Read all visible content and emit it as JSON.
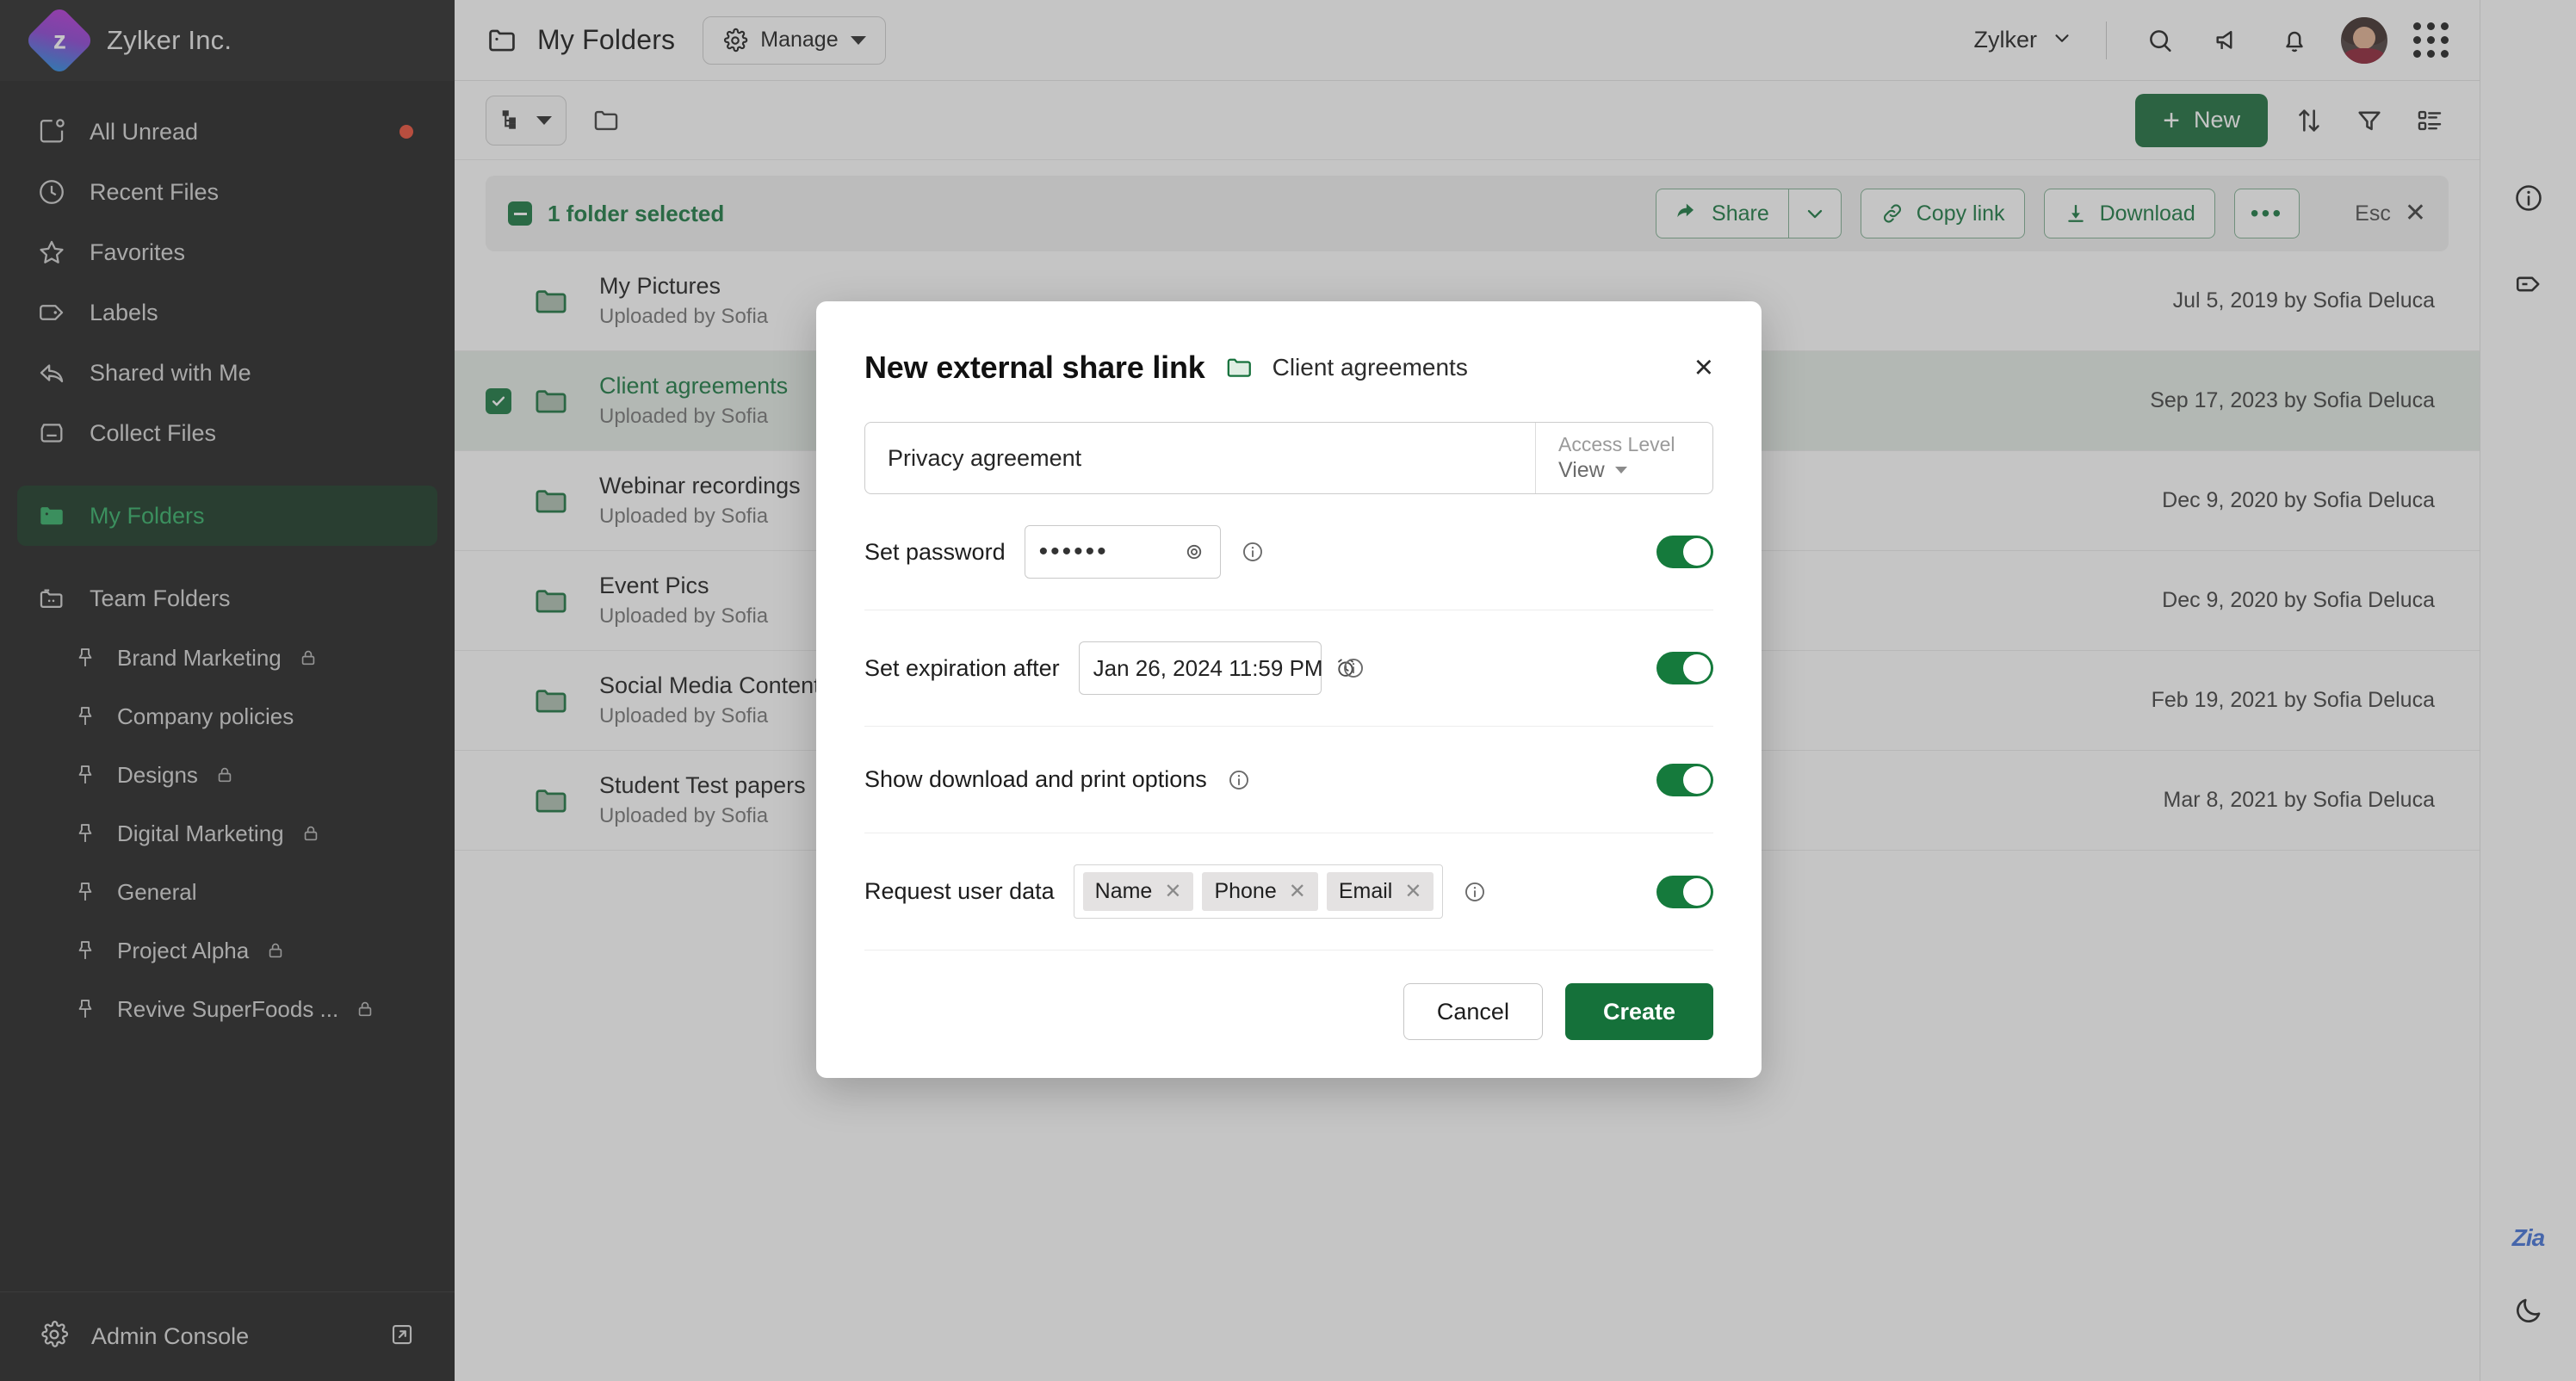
{
  "brand": {
    "name": "Zylker Inc.",
    "logo_letter": "z"
  },
  "sidebar": {
    "items": [
      {
        "label": "All Unread",
        "icon": "unread-icon",
        "badge": true
      },
      {
        "label": "Recent Files",
        "icon": "clock-icon",
        "badge": false
      },
      {
        "label": "Favorites",
        "icon": "star-icon",
        "badge": false
      },
      {
        "label": "Labels",
        "icon": "label-icon",
        "badge": false
      },
      {
        "label": "Shared with Me",
        "icon": "share-back-icon",
        "badge": false
      },
      {
        "label": "Collect Files",
        "icon": "inbox-icon",
        "badge": false
      },
      {
        "label": "My Folders",
        "icon": "folder-icon",
        "badge": false,
        "active": true
      }
    ],
    "team_folders": {
      "label": "Team Folders",
      "icon": "team-folder-icon"
    },
    "team_items": [
      {
        "label": "Brand Marketing",
        "locked": true
      },
      {
        "label": "Company policies",
        "locked": false
      },
      {
        "label": "Designs",
        "locked": true
      },
      {
        "label": "Digital Marketing",
        "locked": true
      },
      {
        "label": "General",
        "locked": false
      },
      {
        "label": "Project Alpha",
        "locked": true
      },
      {
        "label": "Revive SuperFoods ...",
        "locked": true
      }
    ],
    "footer": {
      "label": "Admin Console",
      "icon": "gear-icon",
      "external_icon": "external-link-icon"
    }
  },
  "topbar": {
    "title": "My Folders",
    "manage_label": "Manage",
    "org_label": "Zylker",
    "icons": [
      "search-icon",
      "announcement-icon",
      "bell-icon",
      "apps-grid-icon"
    ]
  },
  "actionbar": {
    "new_label": "New",
    "icons": [
      "tree-view-icon",
      "folder-outline-icon",
      "sort-icon",
      "filter-icon",
      "list-options-icon"
    ]
  },
  "selection": {
    "count_label": "1 folder selected",
    "share_label": "Share",
    "copy_link_label": "Copy link",
    "download_label": "Download",
    "more_label": "•••",
    "esc_label": "Esc"
  },
  "list": {
    "uploaded_prefix": "Uploaded by Sofia",
    "rows": [
      {
        "name": "My Pictures",
        "sub": "Uploaded by Sofia",
        "date": "Jul 5, 2019 by Sofia Deluca",
        "selected": false
      },
      {
        "name": "Client agreements",
        "sub": "Uploaded by Sofia",
        "date": "Sep 17, 2023 by Sofia Deluca",
        "selected": true
      },
      {
        "name": "Webinar recordings",
        "sub": "Uploaded by Sofia",
        "date": "Dec 9, 2020 by Sofia Deluca",
        "selected": false
      },
      {
        "name": "Event Pics",
        "sub": "Uploaded by Sofia",
        "date": "Dec 9, 2020 by Sofia Deluca",
        "selected": false
      },
      {
        "name": "Social Media Content",
        "sub": "Uploaded by Sofia",
        "date": "Feb 19, 2021 by Sofia Deluca",
        "selected": false
      },
      {
        "name": "Student Test papers",
        "sub": "Uploaded by Sofia",
        "date": "Mar 8, 2021 by Sofia Deluca",
        "selected": false
      }
    ]
  },
  "rail": {
    "icons": [
      "info-icon",
      "tag-icon"
    ],
    "zia_label": "Zia",
    "theme_icon": "moon-icon"
  },
  "modal": {
    "title": "New external share link",
    "folder_name": "Client agreements",
    "close_label": "×",
    "link_name": "Privacy agreement",
    "access_level_label": "Access Level",
    "access_level_value": "View",
    "rows": [
      {
        "label": "Set password",
        "value": "••••••",
        "trailing_icon": "eye-icon",
        "enabled": true
      },
      {
        "label": "Set expiration after",
        "value": "Jan 26, 2024 11:59 PM",
        "trailing_icon": "alarm-icon",
        "enabled": true
      },
      {
        "label": "Show download and print options",
        "value": null,
        "trailing_icon": null,
        "enabled": true
      },
      {
        "label": "Request user data",
        "value": null,
        "trailing_icon": null,
        "enabled": true
      }
    ],
    "user_data_chips": [
      "Name",
      "Phone",
      "Email"
    ],
    "cancel_label": "Cancel",
    "create_label": "Create"
  },
  "colors": {
    "accent_green": "#15753d",
    "sidebar_bg": "#1d1d1d",
    "selected_row": "#e4ece6",
    "badge_red": "#ea4b35",
    "zia_blue": "#3f6fd8"
  }
}
